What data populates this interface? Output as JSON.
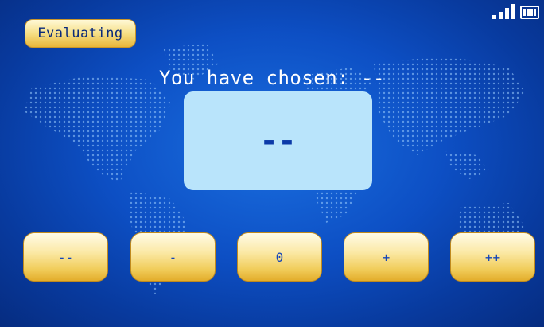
{
  "status_badge": {
    "label": "Evaluating"
  },
  "prompt": {
    "text": "You have chosen: --"
  },
  "display": {
    "value": "--"
  },
  "rating_buttons": [
    {
      "label": "--"
    },
    {
      "label": "-"
    },
    {
      "label": "0"
    },
    {
      "label": "+"
    },
    {
      "label": "++"
    }
  ],
  "status_icons": {
    "signal": "signal-strength-icon",
    "battery": "battery-icon"
  },
  "colors": {
    "background": "#0d4fc4",
    "badge": "#f6df86",
    "button": "#f1cd5c",
    "display_panel": "#b9e4fb",
    "display_text": "#0c3aa8",
    "button_text": "#1546b8"
  }
}
